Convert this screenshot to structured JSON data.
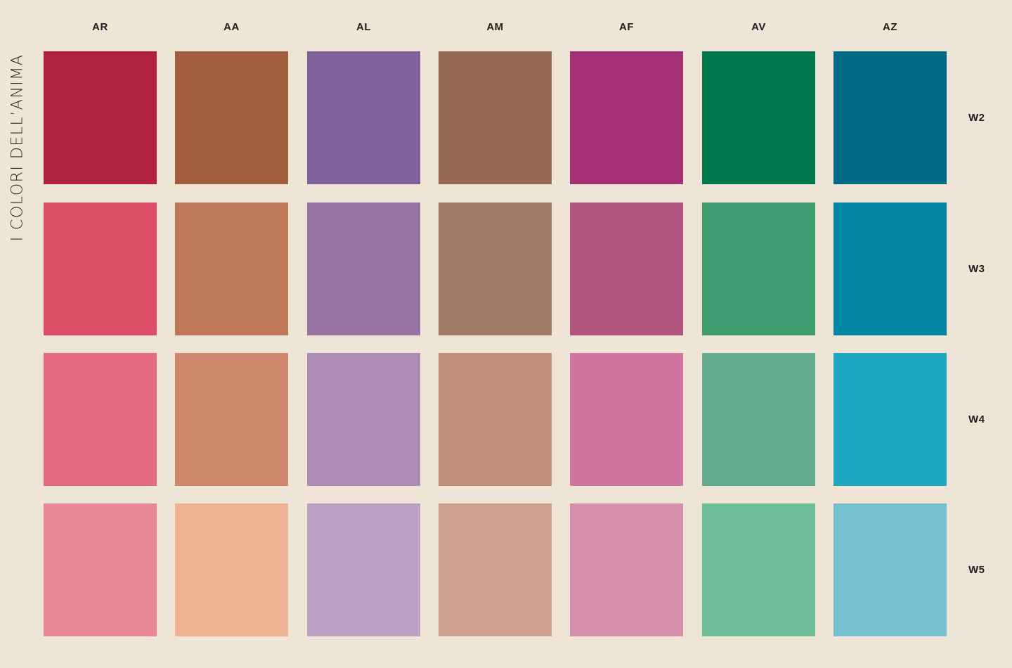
{
  "title": "I COLORI DELL’ANIMA",
  "columns": [
    "AR",
    "AA",
    "AL",
    "AM",
    "AF",
    "AV",
    "AZ"
  ],
  "rows": [
    {
      "label": "W2",
      "colors": [
        "#B1223C",
        "#A15E3F",
        "#80629A",
        "#956953",
        "#A52F74",
        "#00784D",
        "#006B86"
      ]
    },
    {
      "label": "W3",
      "colors": [
        "#DD4F67",
        "#BD7859",
        "#9774A4",
        "#A37A68",
        "#B1557F",
        "#419B70",
        "#0085A4"
      ]
    },
    {
      "label": "W4",
      "colors": [
        "#E56C7F",
        "#CE886B",
        "#AC8DB6",
        "#BF917C",
        "#D0759E",
        "#62AD8D",
        "#1FA7C1"
      ]
    },
    {
      "label": "W5",
      "colors": [
        "#E98797",
        "#EDB292",
        "#BCA2C2",
        "#CEA08F",
        "#D68EAC",
        "#6DBC97",
        "#76C1D0"
      ]
    }
  ]
}
